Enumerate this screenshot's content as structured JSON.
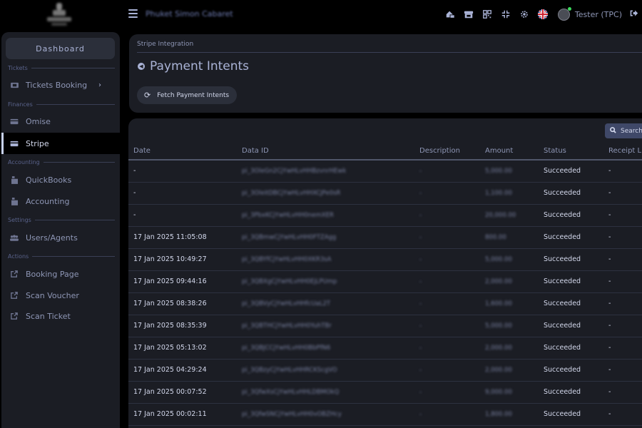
{
  "topbar": {
    "site_title": "Phuket Simon Cabaret",
    "user_name": "Tester (TPC)",
    "icons": [
      "home-switch-icon",
      "store-icon",
      "qr-code-icon",
      "compress-icon",
      "gear-icon",
      "uk-flag-icon",
      "avatar-icon",
      "logout-icon"
    ]
  },
  "sidebar": {
    "dashboard_label": "Dashboard",
    "sections": [
      {
        "label": "Tickets",
        "items": [
          {
            "label": "Tickets Booking",
            "icon": "ticket-icon",
            "has_chevron": true
          }
        ]
      },
      {
        "label": "Finances",
        "items": [
          {
            "label": "Omise",
            "icon": "card-icon"
          },
          {
            "label": "Stripe",
            "icon": "card-icon",
            "active": true
          }
        ]
      },
      {
        "label": "Accounting",
        "items": [
          {
            "label": "QuickBooks",
            "icon": "cash-register-icon"
          },
          {
            "label": "Accounting",
            "icon": "cash-register-icon"
          }
        ]
      },
      {
        "label": "Settings",
        "items": [
          {
            "label": "Users/Agents",
            "icon": "users-icon"
          }
        ]
      },
      {
        "label": "Actions",
        "items": [
          {
            "label": "Booking Page",
            "icon": "external-link-icon"
          },
          {
            "label": "Scan Voucher",
            "icon": "external-link-icon"
          },
          {
            "label": "Scan Ticket",
            "icon": "external-link-icon"
          }
        ]
      }
    ],
    "chevron": "›"
  },
  "header": {
    "breadcrumb": "Stripe Integration",
    "title": "Payment Intents",
    "fetch_button": "Fetch Payment Intents"
  },
  "table": {
    "search_label": "Search",
    "columns": [
      "Date",
      "Data ID",
      "Description",
      "Amount",
      "Status",
      "Receipt Li"
    ],
    "rows": [
      {
        "date": "-",
        "id": "pi_3OleGn2CjYwHLvHHBzvnrHEwk",
        "desc": "-",
        "amount": "5,000.00",
        "status": "Succeeded",
        "receipt": "-"
      },
      {
        "date": "-",
        "id": "pi_3OleitDBCjYwHLvHHXCJPe0sR",
        "desc": "-",
        "amount": "1,100.00",
        "status": "Succeeded",
        "receipt": "-"
      },
      {
        "date": "-",
        "id": "pi_3PbxKCjYwHLvHH0nemXER",
        "desc": "-",
        "amount": "20,000.00",
        "status": "Succeeded",
        "receipt": "-"
      },
      {
        "date": "17 Jan 2025 11:05:08",
        "id": "pi_3QBmwCjYwHLvHH0FTZAgg",
        "desc": "-",
        "amount": "800.00",
        "status": "Succeeded",
        "receipt": "-"
      },
      {
        "date": "17 Jan 2025 10:49:27",
        "id": "pi_3QBYfCjYwHLvHH0XKR3sA",
        "desc": "-",
        "amount": "5,000.00",
        "status": "Succeeded",
        "receipt": "-"
      },
      {
        "date": "17 Jan 2025 09:44:16",
        "id": "pi_3QBXgCjYwHLvHH0EjLPUmp",
        "desc": "-",
        "amount": "2,000.00",
        "status": "Succeeded",
        "receipt": "-"
      },
      {
        "date": "17 Jan 2025 08:38:26",
        "id": "pi_3QBVyCjYwHLvHHfcUaL2T",
        "desc": "-",
        "amount": "1,600.00",
        "status": "Succeeded",
        "receipt": "-"
      },
      {
        "date": "17 Jan 2025 08:35:39",
        "id": "pi_3QBTHCjYwHLvHH0YuhTBr",
        "desc": "-",
        "amount": "5,000.00",
        "status": "Succeeded",
        "receipt": "-"
      },
      {
        "date": "17 Jan 2025 05:13:02",
        "id": "pi_3QBJCCjYwHLvHH0BbPfN6",
        "desc": "-",
        "amount": "2,000.00",
        "status": "Succeeded",
        "receipt": "-"
      },
      {
        "date": "17 Jan 2025 04:29:24",
        "id": "pi_3QBzyCjYwHLvHHRCKScgVO",
        "desc": "-",
        "amount": "2,000.00",
        "status": "Succeeded",
        "receipt": "-"
      },
      {
        "date": "17 Jan 2025 00:07:52",
        "id": "pi_3QfwXsCjYwHLvHHLDBMOkQ",
        "desc": "-",
        "amount": "9,000.00",
        "status": "Succeeded",
        "receipt": "-"
      },
      {
        "date": "17 Jan 2025 00:02:11",
        "id": "pi_3QfwSNCjYwHLvHH0vOBZHcy",
        "desc": "-",
        "amount": "1,800.00",
        "status": "Succeeded",
        "receipt": "-"
      }
    ]
  }
}
